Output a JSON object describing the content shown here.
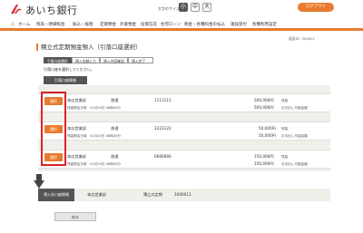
{
  "header": {
    "bank_name": "あいち銀行",
    "text_size_label": "文字のサイズ",
    "size_small": "小",
    "size_medium": "中",
    "size_large": "大",
    "logout_label": "ログアウト",
    "accent_color": "#e87b2e"
  },
  "nav": {
    "items": [
      "ホーム",
      "残高・明細照会",
      "振込・振替",
      "定期預金",
      "外貨預金",
      "投資信託",
      "住宅ローン",
      "税金・各種料金の払込",
      "諸届受付",
      "各種利用設定"
    ]
  },
  "screen_id": "画面ID：BAJ001",
  "page": {
    "title": "積立式定期預金預入（引落口座選択）",
    "steps": [
      "引落口座選択",
      "預入金額入力",
      "預入内容確認",
      "預入完了"
    ],
    "instruction": "引落口座を選択してください。",
    "section_label": "引落口座情報"
  },
  "accounts": [
    {
      "select_label": "選択",
      "branch": "本店営業部",
      "type": "普通",
      "number": "1111111",
      "balance": "500,000円",
      "balance_label": "残高",
      "available": "500,000円",
      "available_label": "お引出し可能金額",
      "ref_date": "残高照会日時　01月20日 08時30分"
    },
    {
      "select_label": "選択",
      "branch": "本店営業部",
      "type": "普通",
      "number": "2222222",
      "balance": "50,000円",
      "balance_label": "残高",
      "available": "50,000円",
      "available_label": "お引出し可能金額",
      "ref_date": "残高照会日時　01月20日 08時30分"
    },
    {
      "select_label": "選択",
      "branch": "本店営業部",
      "type": "普通",
      "number": "6666666",
      "balance": "150,000円",
      "balance_label": "残高",
      "available": "150,000円",
      "available_label": "お引出し可能金額",
      "ref_date": "残高照会日時　01月20日 08時30分"
    }
  ],
  "destination": {
    "label": "預入先口座情報",
    "branch": "本店営業部",
    "type": "積立式定期",
    "number": "1000011"
  },
  "back_label": "戻る"
}
